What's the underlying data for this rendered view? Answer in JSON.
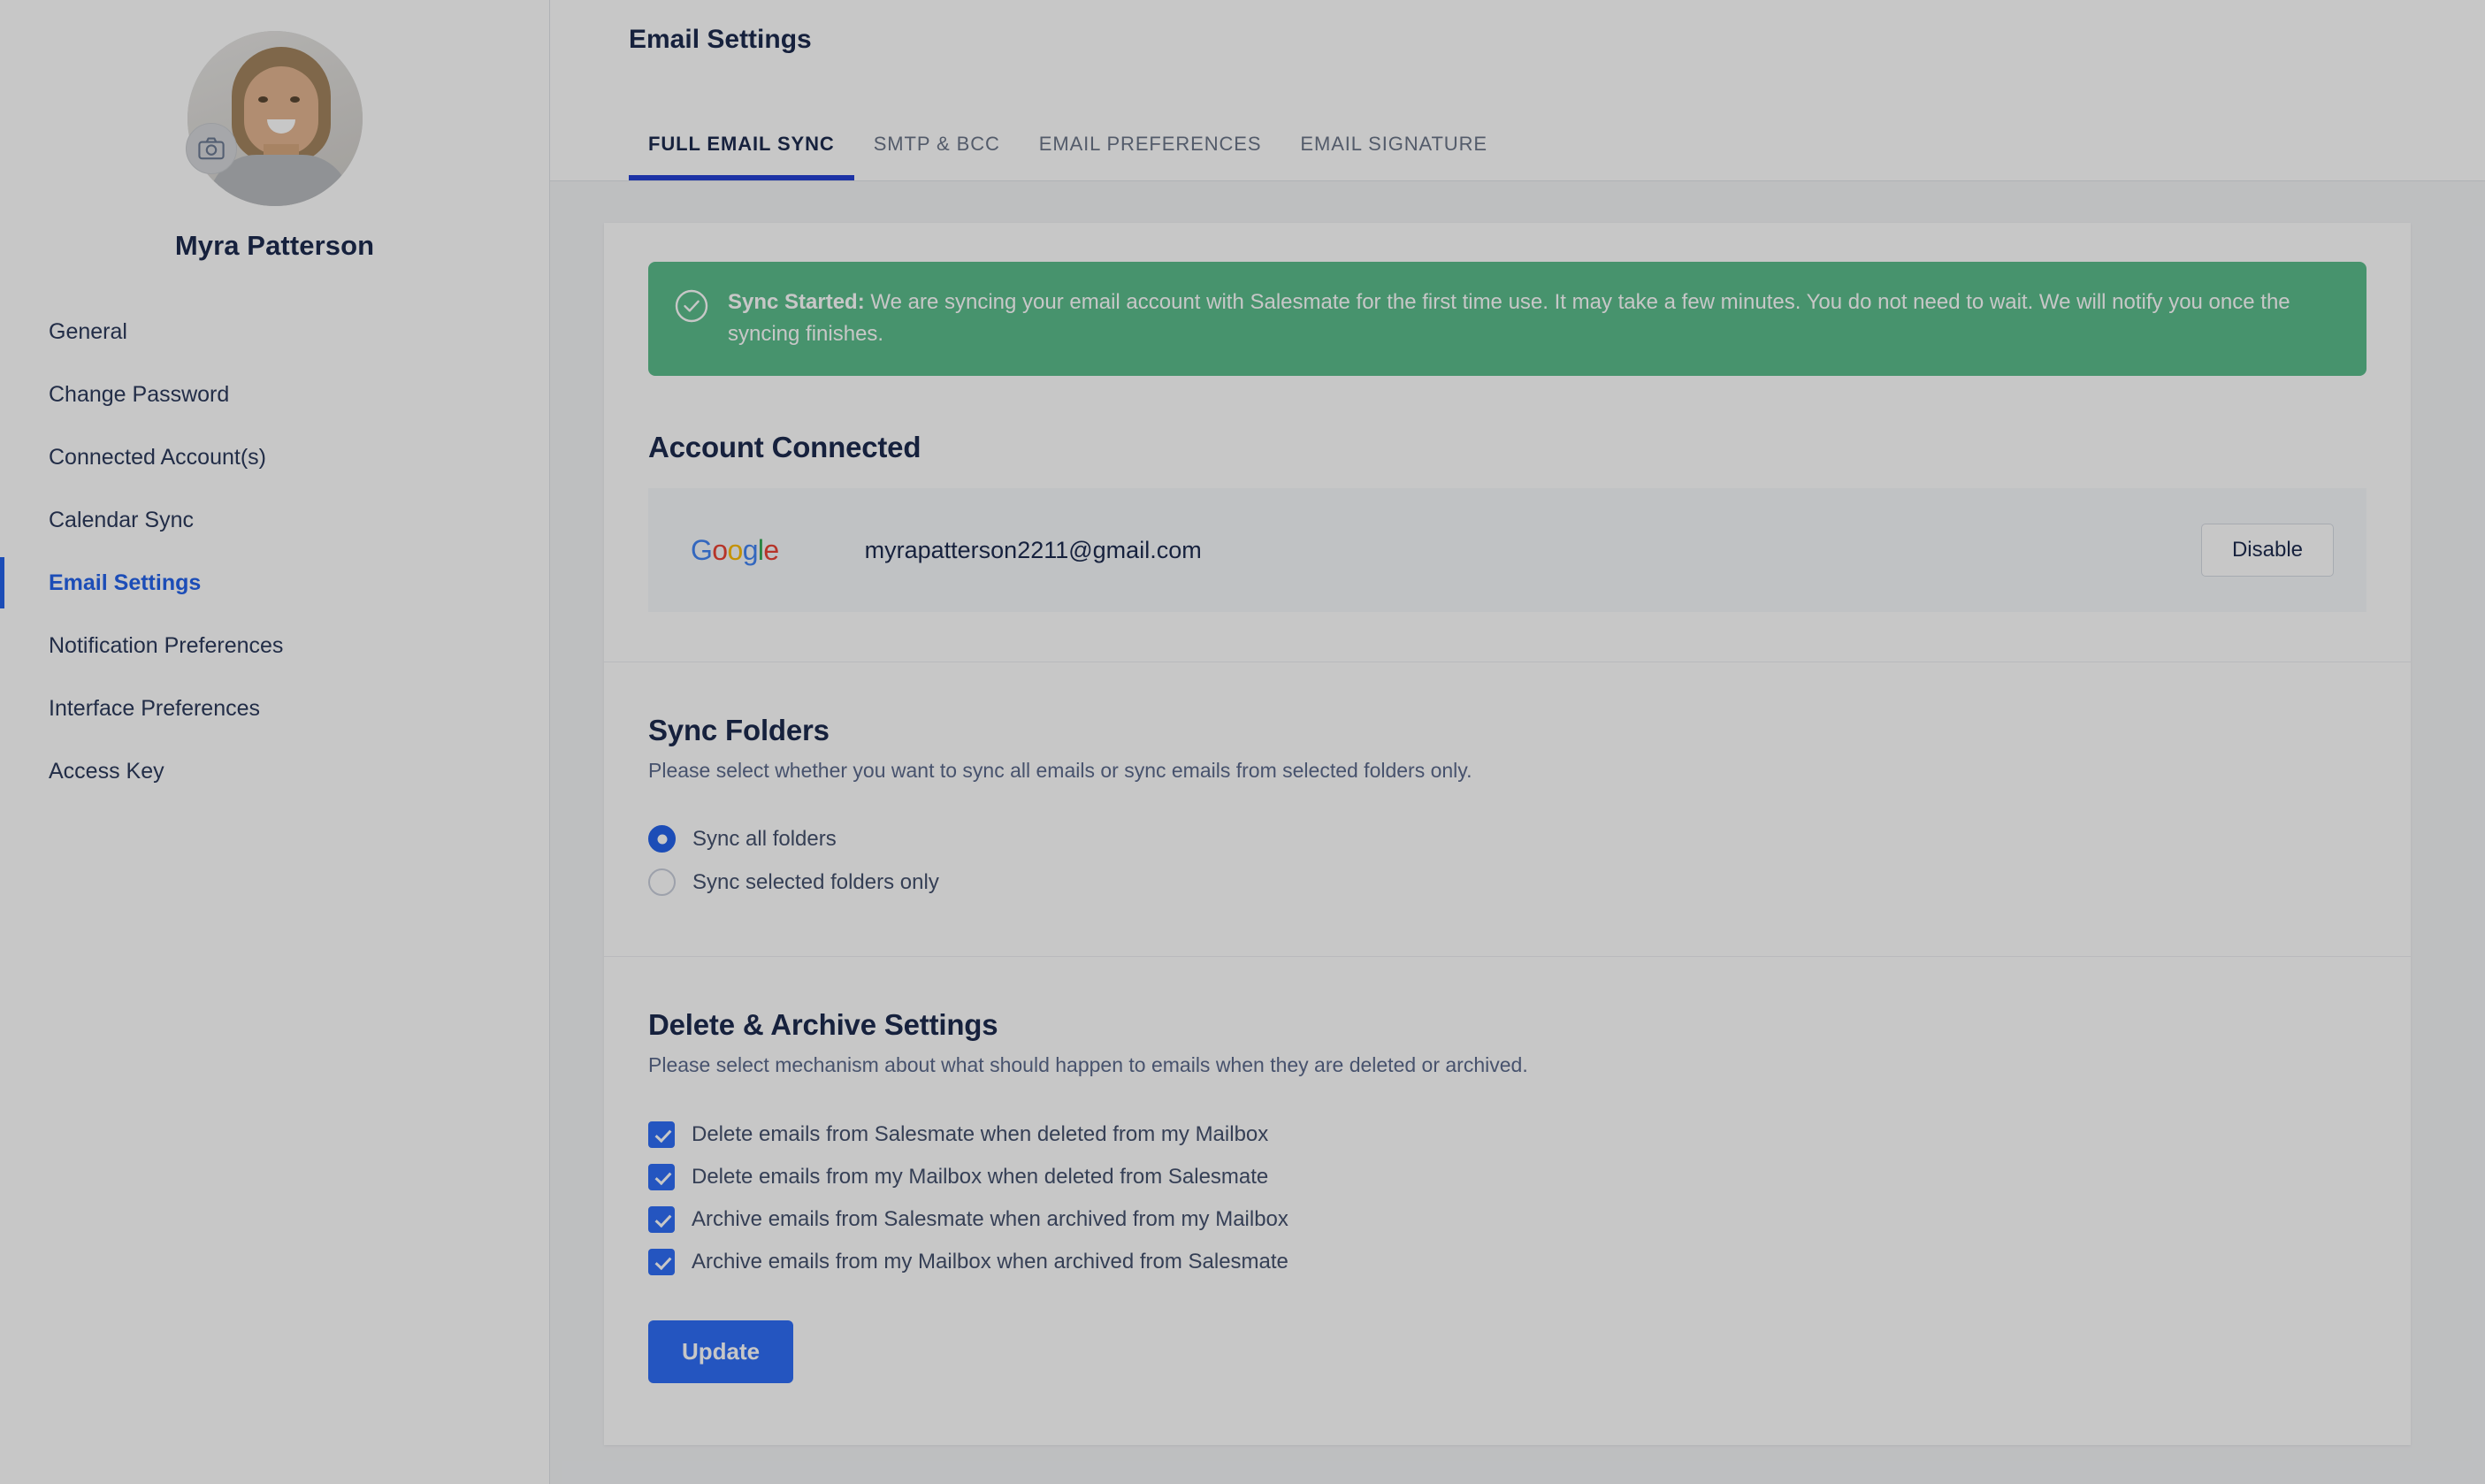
{
  "sidebar": {
    "avatar_icon": "user-avatar-photo",
    "camera_badge_icon": "camera-icon",
    "user_name": "Myra Patterson",
    "items": [
      {
        "label": "General",
        "active": false
      },
      {
        "label": "Change Password",
        "active": false
      },
      {
        "label": "Connected Account(s)",
        "active": false
      },
      {
        "label": "Calendar Sync",
        "active": false
      },
      {
        "label": "Email Settings",
        "active": true
      },
      {
        "label": "Notification Preferences",
        "active": false
      },
      {
        "label": "Interface Preferences",
        "active": false
      },
      {
        "label": "Access Key",
        "active": false
      }
    ]
  },
  "header": {
    "title": "Email Settings",
    "tabs": [
      {
        "label": "FULL EMAIL SYNC",
        "active": true
      },
      {
        "label": "SMTP & BCC",
        "active": false
      },
      {
        "label": "EMAIL PREFERENCES",
        "active": false
      },
      {
        "label": "EMAIL SIGNATURE",
        "active": false
      }
    ]
  },
  "banner": {
    "icon": "check-circle-icon",
    "strong": "Sync Started:",
    "message": " We are syncing your email account with Salesmate for the first time use. It may take a few minutes. You do not need to wait. We will notify you once the syncing finishes.",
    "background_color": "#5cbd8c"
  },
  "account_connected": {
    "title": "Account Connected",
    "provider_name": "Google",
    "provider_logo_icon": "google-logo-icon",
    "provider_letters": [
      "G",
      "o",
      "o",
      "g",
      "l",
      "e"
    ],
    "email": "myrapatterson2211@gmail.com",
    "disable_label": "Disable"
  },
  "sync_folders": {
    "title": "Sync Folders",
    "subtitle": "Please select whether you want to sync all emails or sync emails from selected folders only.",
    "options": [
      {
        "label": "Sync all folders",
        "selected": true
      },
      {
        "label": "Sync selected folders only",
        "selected": false
      }
    ]
  },
  "delete_archive": {
    "title": "Delete & Archive Settings",
    "subtitle": "Please select mechanism about what should happen to emails when they are deleted or archived.",
    "checkboxes": [
      {
        "label": "Delete emails from Salesmate when deleted from my Mailbox",
        "checked": true
      },
      {
        "label": "Delete emails from my Mailbox when deleted from Salesmate",
        "checked": true
      },
      {
        "label": "Archive emails from Salesmate when archived from my Mailbox",
        "checked": true
      },
      {
        "label": "Archive emails from my Mailbox when archived from Salesmate",
        "checked": true
      }
    ],
    "update_label": "Update"
  },
  "colors": {
    "accent_blue": "#2563eb",
    "button_blue": "#2f6df6",
    "success_green": "#5cbd8c",
    "tab_underline": "#2541d4",
    "text_dark": "#1d2b4f"
  }
}
